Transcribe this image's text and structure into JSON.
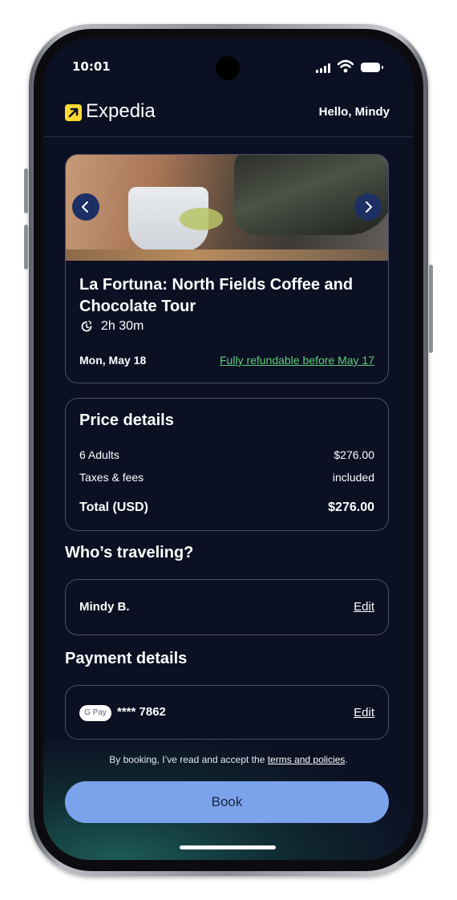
{
  "status_bar": {
    "time": "10:01"
  },
  "header": {
    "brand": "Expedia",
    "greeting": "Hello, Mindy"
  },
  "activity": {
    "title": "La Fortuna: North Fields Coffee and Chocolate Tour",
    "duration": "2h 30m",
    "date": "Mon, May 18",
    "refund_text": "Fully refundable before May 17",
    "prev_icon": "chevron-left-icon",
    "next_icon": "chevron-right-icon"
  },
  "price_details": {
    "title": "Price details",
    "rows": [
      {
        "label": "6 Adults",
        "value": "$276.00"
      },
      {
        "label": "Taxes & fees",
        "value": "included"
      }
    ],
    "total": {
      "label": "Total (USD)",
      "value": "$276.00"
    }
  },
  "travelers": {
    "title": "Who’s traveling?",
    "name": "Mindy B.",
    "edit_label": "Edit"
  },
  "payment": {
    "title": "Payment details",
    "method_badge": "G Pay",
    "card": "**** 7862",
    "edit_label": "Edit"
  },
  "terms": {
    "prefix": "By booking, I’ve read and accept the ",
    "link": "terms and policies",
    "suffix": "."
  },
  "book_label": "Book",
  "colors": {
    "background": "#0c1023",
    "accent_button": "#7ba3ec",
    "refund_green": "#5fcf79",
    "logo_yellow": "#fddb32"
  }
}
